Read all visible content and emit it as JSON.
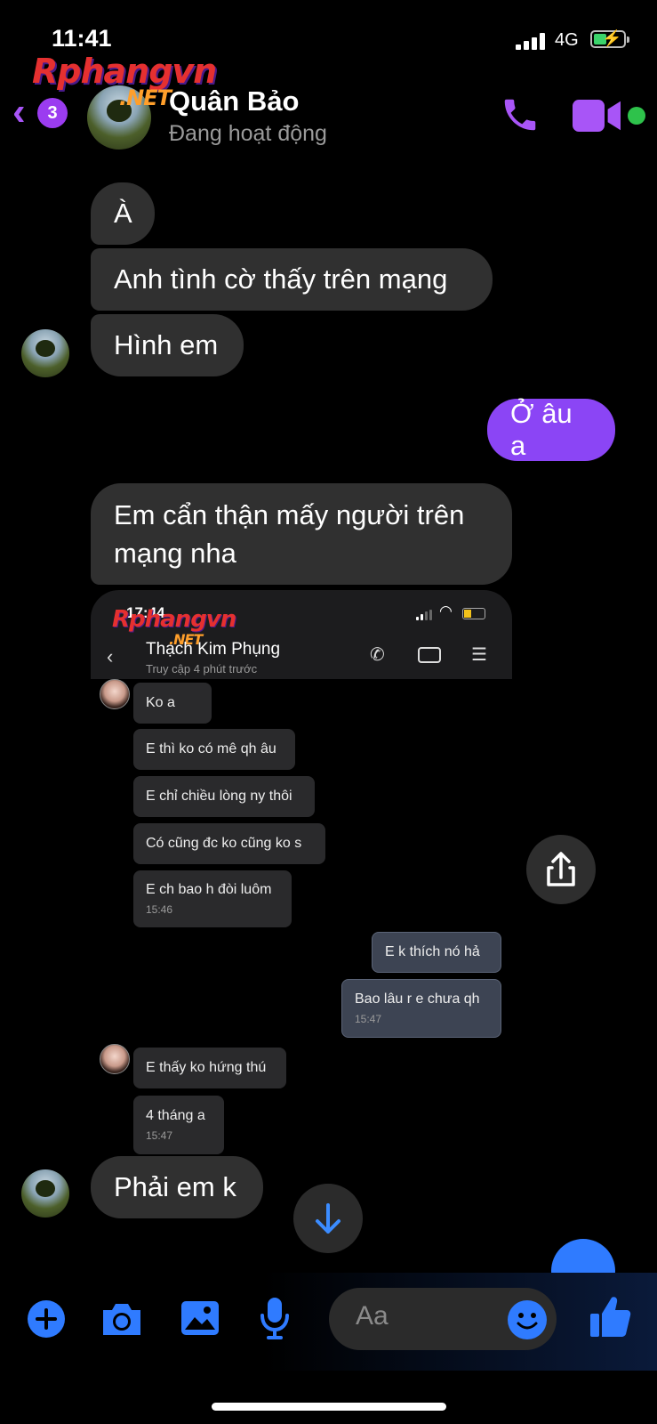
{
  "status_bar": {
    "time": "11:41",
    "network": "4G"
  },
  "watermark": {
    "brand": "Rphangvn",
    "tld": ".NET"
  },
  "header": {
    "back_badge_count": "3",
    "contact_name": "Quân Bảo",
    "contact_status": "Đang hoạt động"
  },
  "messages": [
    {
      "sender": "them",
      "text": "À"
    },
    {
      "sender": "them",
      "text": "Anh tình cờ thấy trên mạng"
    },
    {
      "sender": "them",
      "text": "Hình em"
    },
    {
      "sender": "me",
      "text": "Ở âu a"
    },
    {
      "sender": "them",
      "text_line1": "Em cẩn thận mấy người trên",
      "text_line2": "mạng nha"
    },
    {
      "sender": "them",
      "text": "Phải em k"
    }
  ],
  "embedded_screenshot": {
    "time": "17:44",
    "contact_name": "Thạch Kim Phụng",
    "contact_status": "Truy cập 4 phút trước",
    "messages": [
      {
        "sender": "them",
        "text": "Ko a"
      },
      {
        "sender": "them",
        "text": "E thì ko có mê qh âu"
      },
      {
        "sender": "them",
        "text": "E chỉ chiều lòng ny thôi"
      },
      {
        "sender": "them",
        "text": "Có cũng đc ko cũng ko s"
      },
      {
        "sender": "them",
        "text": "E ch bao h đòi luôm",
        "time": "15:46"
      },
      {
        "sender": "me",
        "text": "E k thích nó hả"
      },
      {
        "sender": "me",
        "text": "Bao lâu r e chưa qh",
        "time": "15:47"
      },
      {
        "sender": "them",
        "text": "E thấy ko hứng thú"
      },
      {
        "sender": "them",
        "text": "4 tháng a",
        "time": "15:47"
      }
    ]
  },
  "composer": {
    "placeholder": "Aa"
  },
  "colors": {
    "accent_purple": "#8b45f5",
    "accent_blue": "#2f7bff",
    "bubble_gray": "#303030",
    "online_green": "#2ec24b"
  },
  "icons": [
    "back-chevron-icon",
    "phone-icon",
    "video-camera-icon",
    "share-icon",
    "arrow-down-icon",
    "plus-icon",
    "camera-icon",
    "gallery-icon",
    "microphone-icon",
    "emoji-icon",
    "thumbs-up-icon"
  ]
}
